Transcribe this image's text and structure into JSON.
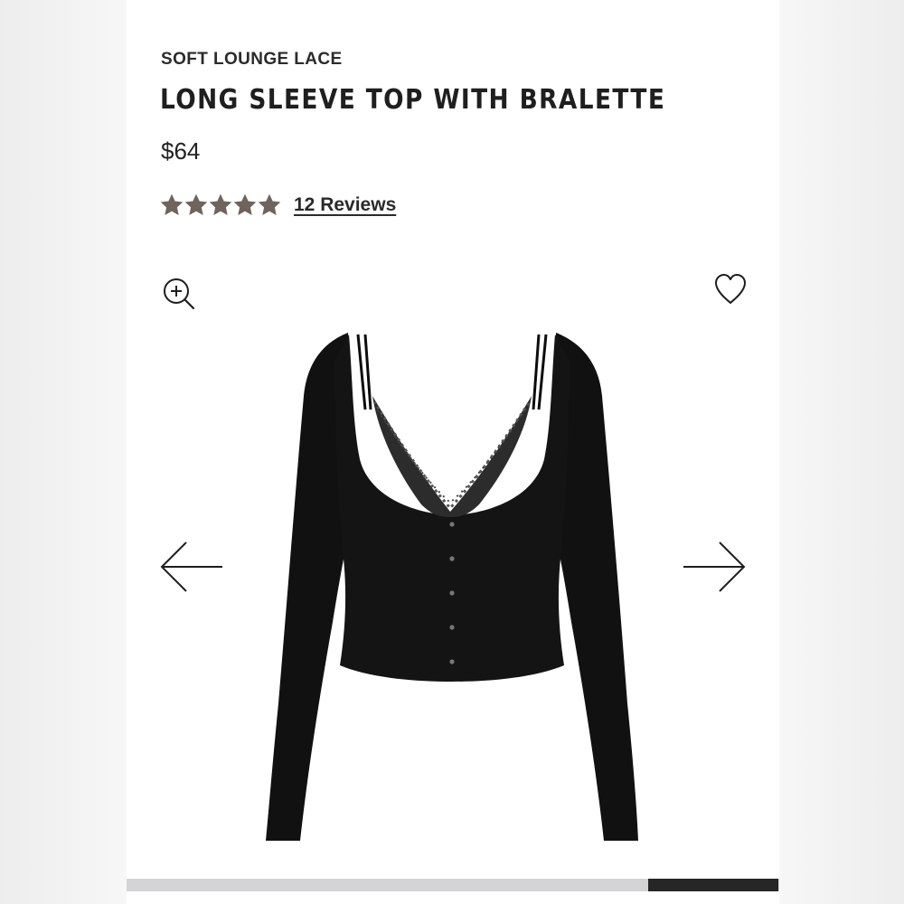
{
  "product": {
    "collection": "SOFT LOUNGE LACE",
    "title": "LONG SLEEVE TOP WITH BRALETTE",
    "price": "$64",
    "rating": {
      "stars": 5,
      "max_stars": 5,
      "reviews_label": "12 Reviews"
    }
  },
  "icons": {
    "zoom": "zoom-in-icon",
    "favorite": "heart-icon",
    "previous": "arrow-left-icon",
    "next": "arrow-right-icon",
    "star": "star-icon"
  },
  "gallery": {
    "image": "black long sleeve top with lace bralette",
    "progress": {
      "position": 0.8,
      "fill_fraction": 0.2
    }
  },
  "colors": {
    "star": "#6e645b",
    "text": "#222222",
    "progress_track": "#d4d4d6",
    "progress_fill": "#262626"
  }
}
